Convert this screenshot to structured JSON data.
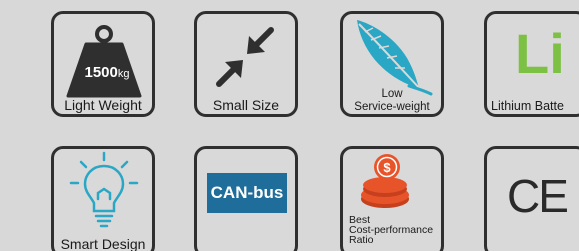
{
  "features": [
    {
      "id": "light-weight",
      "badge_number": "1500",
      "badge_unit": "kg",
      "caption": "Light Weight",
      "icon": "weight-icon",
      "color": "#2f2f2f"
    },
    {
      "id": "small-size",
      "caption": "Small Size",
      "icon": "compress-arrows-icon",
      "color": "#2f2f2f"
    },
    {
      "id": "low-service-weight",
      "caption_line1": "Low",
      "caption_line2": "Service-weight",
      "icon": "feather-icon",
      "color": "#2aa7c5"
    },
    {
      "id": "lithium-battery",
      "symbol": "Li",
      "caption": "Lithium Batte",
      "icon": "lithium-symbol",
      "color": "#7cc143"
    },
    {
      "id": "smart-design",
      "caption": "Smart Design",
      "icon": "lightbulb-icon",
      "color": "#2aa7c5"
    },
    {
      "id": "can-bus",
      "label": "CAN-bus",
      "icon": "canbus-badge",
      "color": "#1f6d9a"
    },
    {
      "id": "best-cost-performance",
      "caption_line1": "Best",
      "caption_line2": "Cost-performance",
      "caption_line3": "Ratio",
      "icon": "coins-icon",
      "color": "#e8542a"
    },
    {
      "id": "ce-mark",
      "symbol": "CE",
      "icon": "ce-mark-icon",
      "color": "#2a2a2a"
    }
  ]
}
